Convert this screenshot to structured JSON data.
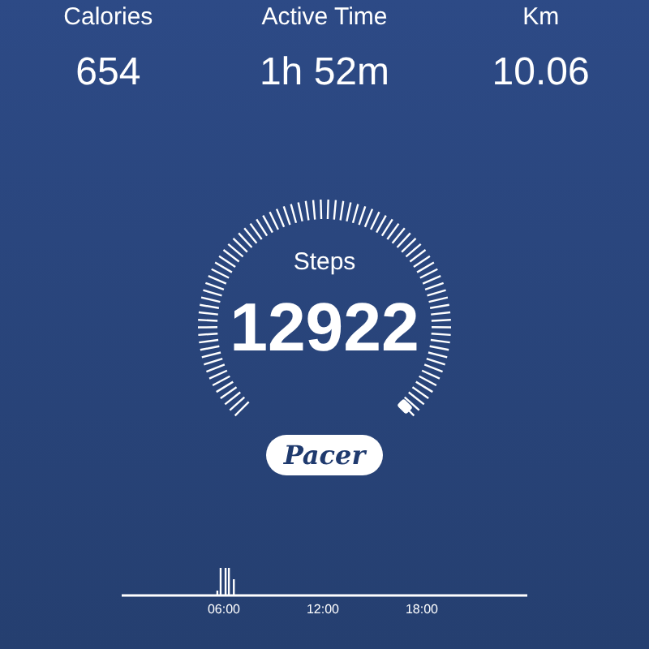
{
  "stats": [
    {
      "label": "Calories",
      "value": "654"
    },
    {
      "label": "Active Time",
      "value": "1h 52m"
    },
    {
      "label": "Km",
      "value": "10.06"
    }
  ],
  "gauge": {
    "label": "Steps",
    "value": "12922"
  },
  "brand_button": {
    "label": "Pacer"
  },
  "activity": {
    "axis_labels": [
      "06:00",
      "12:00",
      "18:00"
    ]
  }
}
